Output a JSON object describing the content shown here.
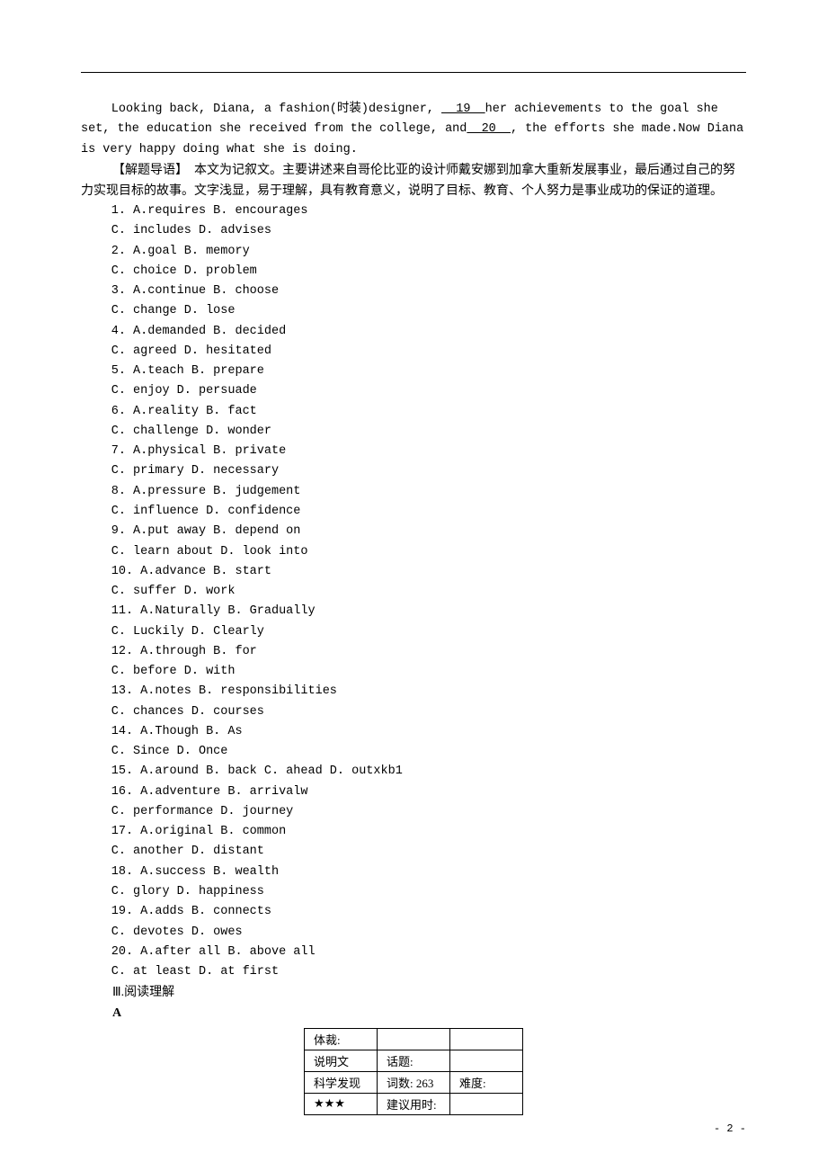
{
  "passage": {
    "p1_prefix": "Looking back, Diana, a fashion(时装)designer, ",
    "blank19": "  19  ",
    "p1_mid": "her achievements to the goal she set, the education she received from the college, and",
    "blank20": "  20  ",
    "p1_suffix": ", the efforts she made.Now Diana is very happy doing what she is doing."
  },
  "guide": {
    "label": "【解题导语】",
    "text": "　本文为记叙文。主要讲述来自哥伦比亚的设计师戴安娜到加拿大重新发展事业，最后通过自己的努力实现目标的故事。文字浅显，易于理解，具有教育意义，说明了目标、教育、个人努力是事业成功的保证的道理。"
  },
  "questions": [
    "1. A.requires  B. encourages",
    "C. includes  D. advises",
    "2. A.goal  B. memory",
    "C. choice  D. problem",
    "3. A.continue  B. choose",
    "C. change  D. lose",
    "4. A.demanded  B. decided",
    "C. agreed  D. hesitated",
    "5. A.teach  B. prepare",
    "C. enjoy  D. persuade",
    "6. A.reality  B. fact",
    "C. challenge  D. wonder",
    "7. A.physical  B. private",
    "C. primary  D. necessary",
    "8. A.pressure  B. judgement",
    "C. influence  D. confidence",
    "9. A.put away  B. depend on",
    "C. learn about  D. look into",
    "10. A.advance  B. start",
    "C. suffer  D. work",
    "11. A.Naturally  B. Gradually",
    "C. Luckily  D. Clearly",
    "12. A.through  B. for",
    "C. before  D. with",
    "13. A.notes  B. responsibilities",
    "C. chances  D. courses",
    "14. A.Though  B. As",
    "C. Since  D. Once",
    "15. A.around    B. back  C. ahead  D. outxkb1",
    "16. A.adventure  B. arrivalw",
    "C. performance  D. journey",
    "17. A.original  B. common",
    "C. another  D. distant",
    "18. A.success  B. wealth",
    "C. glory  D. happiness",
    "19. A.adds  B. connects",
    "C. devotes  D. owes",
    "20. A.after all  B. above all",
    "C. at least  D. at first"
  ],
  "section3": "Ⅲ.阅读理解",
  "sectionA": "A",
  "table": {
    "r1c1": "体裁:",
    "r1c2": "",
    "r1c3": "",
    "r2c1": "说明文",
    "r2c2": "话题:",
    "r2c3": "",
    "r3c1": "科学发现",
    "r3c2": "词数: 263",
    "r3c3": "难度:",
    "r4c1": "★★★",
    "r4c2": "建议用时:",
    "r4c3": ""
  },
  "pageNum": "- 2 -"
}
